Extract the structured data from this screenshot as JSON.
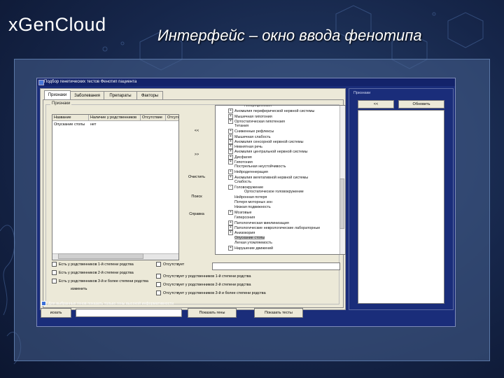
{
  "slide": {
    "logo_x": "x",
    "logo_gen": "Gen",
    "logo_cloud": "Cloud",
    "title": "Интерфейс – окно ввода фенотипа"
  },
  "window": {
    "title": "Подбор генетических тестов   Фенотип пациента",
    "tabs": [
      {
        "label": "Признаки",
        "active": true
      },
      {
        "label": "Заболевания",
        "active": false
      },
      {
        "label": "Препараты",
        "active": false
      },
      {
        "label": "Факторы",
        "active": false
      }
    ],
    "group_label": "Признаки",
    "table": {
      "headers": [
        "Название",
        "Наличие у родственников",
        "Отсутствие",
        "Отсутств"
      ],
      "rows": [
        [
          "Опускание стопы",
          "нет"
        ]
      ]
    },
    "mid_buttons": {
      "add_left": "<<",
      "add_right": ">>",
      "clear": "Очистить",
      "search": "Поиск",
      "help": "Справка"
    },
    "tree_items": [
      {
        "label": "Гипорефлексия",
        "exp": "",
        "indent": 2
      },
      {
        "label": "Аномалия периферической нервной системы",
        "exp": "+",
        "indent": 1
      },
      {
        "label": "Мышечная гипотония",
        "exp": "+",
        "indent": 1
      },
      {
        "label": "Ортостатическая гипотензия",
        "exp": "+",
        "indent": 1
      },
      {
        "label": "Тетания",
        "exp": "",
        "indent": 1
      },
      {
        "label": "Сниженные рефлексы",
        "exp": "+",
        "indent": 1
      },
      {
        "label": "Мышечная слабость",
        "exp": "+",
        "indent": 1
      },
      {
        "label": "Аномалия сенсорной нервной системы",
        "exp": "+",
        "indent": 1
      },
      {
        "label": "Невнятная речь",
        "exp": "+",
        "indent": 1
      },
      {
        "label": "Аномалия центральной нервной системы",
        "exp": "+",
        "indent": 1
      },
      {
        "label": "Дисфагия",
        "exp": "+",
        "indent": 1
      },
      {
        "label": "Гипотония",
        "exp": "+",
        "indent": 1
      },
      {
        "label": "Пострельная неустойчивость",
        "exp": "",
        "indent": 1
      },
      {
        "label": "Нейродегенерация",
        "exp": "+",
        "indent": 1
      },
      {
        "label": "Аномалия вегетативной нервной системы",
        "exp": "+",
        "indent": 1
      },
      {
        "label": "Слабость",
        "exp": "",
        "indent": 1
      },
      {
        "label": "Головокружение",
        "exp": "-",
        "indent": 1
      },
      {
        "label": "Ортостатическое головокружение",
        "exp": "",
        "indent": 2
      },
      {
        "label": "Нейронная потеря",
        "exp": "",
        "indent": 1
      },
      {
        "label": "Потеря моторных зон",
        "exp": "",
        "indent": 1
      },
      {
        "label": "Низкая подвижность",
        "exp": "",
        "indent": 1
      },
      {
        "label": "Мозговые",
        "exp": "+",
        "indent": 1
      },
      {
        "label": "Гиперсония",
        "exp": "",
        "indent": 1
      },
      {
        "label": "Патологическая миелинизация",
        "exp": "+",
        "indent": 1
      },
      {
        "label": "Патологические неврологические лабораторные",
        "exp": "+",
        "indent": 1
      },
      {
        "label": "Анизокория",
        "exp": "+",
        "indent": 1
      },
      {
        "label": "Опускание стопы",
        "exp": "",
        "indent": 1,
        "selected": true
      },
      {
        "label": "Легкая утомляемость",
        "exp": "",
        "indent": 1
      },
      {
        "label": "Нарушение движений",
        "exp": "+",
        "indent": 1
      }
    ],
    "left_checks": [
      "Есть у родственников 1-й степени родства",
      "Есть у родственников 2-й степени родства",
      "Есть у родственников 3-й и более степени родства"
    ],
    "change_label": "изменить",
    "right_checks": [
      "Отсутствует",
      "Отсутствует у родственников 1-й степени родства",
      "Отсутствует у родственников 2-й степени родства",
      "Отсутствует у родственников 3-й и более степени родства"
    ],
    "right_panel": {
      "label": "Признаки",
      "back_btn": "<<",
      "refresh_btn": "Обновить"
    },
    "bottom_check": "Для выбранных генов показать только гены высокой информативности",
    "bottom_buttons": {
      "search": "искать",
      "show_genes": "Показать гены",
      "show_tests": "Показать тесты"
    }
  }
}
